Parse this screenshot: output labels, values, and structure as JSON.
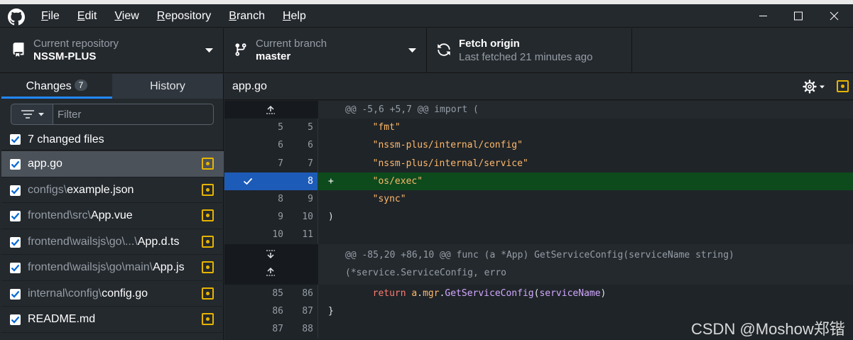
{
  "menu": {
    "items": [
      {
        "label": "File"
      },
      {
        "label": "Edit"
      },
      {
        "label": "View"
      },
      {
        "label": "Repository"
      },
      {
        "label": "Branch"
      },
      {
        "label": "Help"
      }
    ]
  },
  "toolbar": {
    "repository": {
      "caption": "Current repository",
      "value": "NSSM-PLUS"
    },
    "branch": {
      "caption": "Current branch",
      "value": "master"
    },
    "fetch": {
      "title": "Fetch origin",
      "subtitle": "Last fetched 21 minutes ago"
    }
  },
  "sidebar": {
    "tabs": [
      {
        "label": "Changes",
        "count": "7"
      },
      {
        "label": "History"
      }
    ],
    "filter": {
      "placeholder": "Filter"
    },
    "changed_files_label": "7 changed files",
    "files": [
      {
        "dir": "",
        "name": "app.go"
      },
      {
        "dir": "configs\\",
        "name": "example.json"
      },
      {
        "dir": "frontend\\src\\",
        "name": "App.vue"
      },
      {
        "dir": "frontend\\wailsjs\\go\\...\\",
        "name": "App.d.ts"
      },
      {
        "dir": "frontend\\wailsjs\\go\\main\\",
        "name": "App.js"
      },
      {
        "dir": "internal\\config\\",
        "name": "config.go"
      },
      {
        "dir": "",
        "name": "README.md"
      }
    ]
  },
  "diff": {
    "file_title": "app.go",
    "hunk1": "@@ -5,6 +5,7 @@ import (",
    "hunk2": "@@ -85,20 +86,10 @@ func (a *App) GetServiceConfig(serviceName string) (*service.ServiceConfig, erro",
    "lines": [
      {
        "old": "5",
        "new": "5",
        "text": "\"fmt\""
      },
      {
        "old": "6",
        "new": "6",
        "text": "\"nssm-plus/internal/config\""
      },
      {
        "old": "7",
        "new": "7",
        "text": "\"nssm-plus/internal/service\""
      },
      {
        "old": "",
        "new": "8",
        "sign": "+",
        "text": "\"os/exec\""
      },
      {
        "old": "8",
        "new": "9",
        "text": "\"sync\""
      },
      {
        "old": "9",
        "new": "10",
        "text": ")"
      },
      {
        "old": "10",
        "new": "11",
        "text": ""
      }
    ],
    "lines2": [
      {
        "old": "85",
        "new": "86",
        "kw": "return",
        "obj": "a",
        "field": "mgr",
        "fn": "GetServiceConfig",
        "arg": "serviceName"
      },
      {
        "old": "86",
        "new": "87",
        "text": "}"
      },
      {
        "old": "87",
        "new": "88",
        "text": ""
      }
    ]
  },
  "watermark": "CSDN @Moshow郑锴",
  "colors": {
    "accent": "#2188ff",
    "modified": "#e6b400",
    "added_bg": "#0d4b1d",
    "selected_gutter": "#1d5bb8"
  }
}
